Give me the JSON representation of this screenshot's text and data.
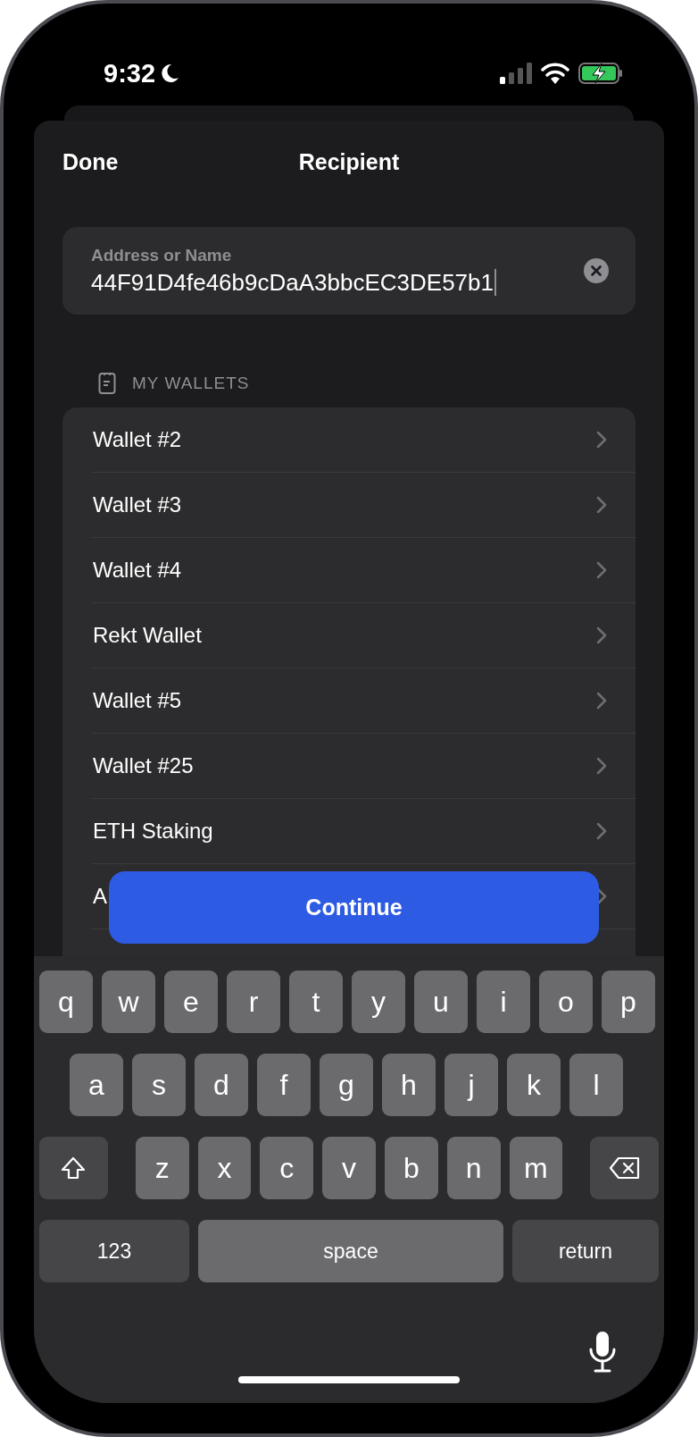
{
  "status_bar": {
    "time": "9:32"
  },
  "header": {
    "left_button": "Done",
    "title": "Recipient"
  },
  "address_field": {
    "label": "Address or Name",
    "value": "44F91D4fe46b9cDaA3bbcEC3DE57b1"
  },
  "section": {
    "title": "MY WALLETS"
  },
  "wallets": [
    {
      "name": "Wallet #2"
    },
    {
      "name": "Wallet #3"
    },
    {
      "name": "Wallet #4"
    },
    {
      "name": "Rekt Wallet"
    },
    {
      "name": "Wallet #5"
    },
    {
      "name": "Wallet #25"
    },
    {
      "name": "ETH Staking"
    },
    {
      "name": "A"
    }
  ],
  "continue_button": "Continue",
  "keyboard": {
    "rows": [
      {
        "keys": [
          {
            "kind": "letter",
            "label": "q"
          },
          {
            "kind": "letter",
            "label": "w"
          },
          {
            "kind": "letter",
            "label": "e"
          },
          {
            "kind": "letter",
            "label": "r"
          },
          {
            "kind": "letter",
            "label": "t"
          },
          {
            "kind": "letter",
            "label": "y"
          },
          {
            "kind": "letter",
            "label": "u"
          },
          {
            "kind": "letter",
            "label": "i"
          },
          {
            "kind": "letter",
            "label": "o"
          },
          {
            "kind": "letter",
            "label": "p"
          }
        ]
      },
      {
        "keys": [
          {
            "kind": "letter",
            "label": "a"
          },
          {
            "kind": "letter",
            "label": "s"
          },
          {
            "kind": "letter",
            "label": "d"
          },
          {
            "kind": "letter",
            "label": "f"
          },
          {
            "kind": "letter",
            "label": "g"
          },
          {
            "kind": "letter",
            "label": "h"
          },
          {
            "kind": "letter",
            "label": "j"
          },
          {
            "kind": "letter",
            "label": "k"
          },
          {
            "kind": "letter",
            "label": "l"
          }
        ]
      },
      {
        "keys": [
          {
            "kind": "shift"
          },
          {
            "kind": "letter",
            "label": "z"
          },
          {
            "kind": "letter",
            "label": "x"
          },
          {
            "kind": "letter",
            "label": "c"
          },
          {
            "kind": "letter",
            "label": "v"
          },
          {
            "kind": "letter",
            "label": "b"
          },
          {
            "kind": "letter",
            "label": "n"
          },
          {
            "kind": "letter",
            "label": "m"
          },
          {
            "kind": "delete"
          }
        ]
      },
      {
        "keys": [
          {
            "kind": "numbers",
            "label": "123"
          },
          {
            "kind": "space",
            "label": "space"
          },
          {
            "kind": "return",
            "label": "return"
          }
        ]
      }
    ]
  }
}
